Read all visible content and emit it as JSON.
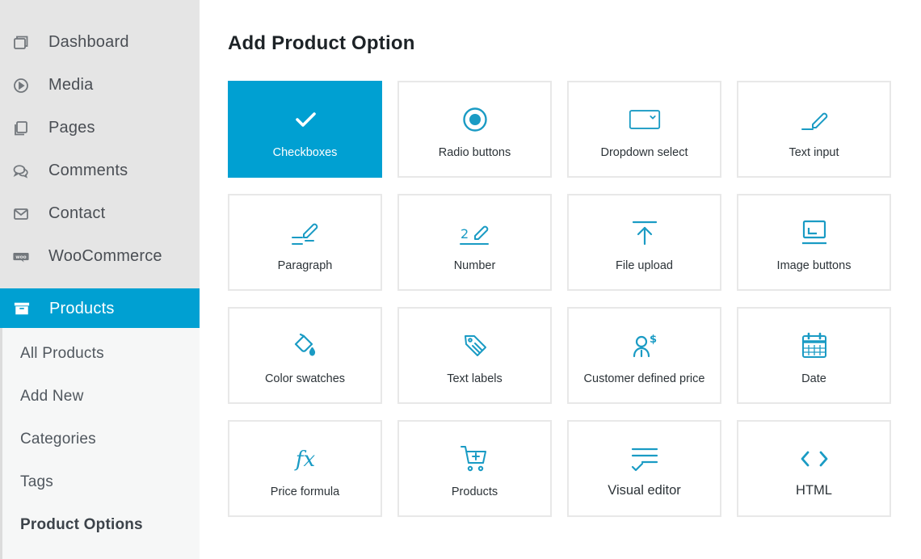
{
  "colors": {
    "accent": "#00a0d2",
    "icon": "#1a9bc4",
    "sidebar_bg": "#e5e5e5",
    "submenu_bg": "#f6f7f7"
  },
  "sidebar": {
    "items": [
      {
        "label": "Dashboard",
        "icon": "dashboard-icon"
      },
      {
        "label": "Media",
        "icon": "media-icon"
      },
      {
        "label": "Pages",
        "icon": "pages-icon"
      },
      {
        "label": "Comments",
        "icon": "comments-icon"
      },
      {
        "label": "Contact",
        "icon": "contact-icon"
      },
      {
        "label": "WooCommerce",
        "icon": "woocommerce-icon"
      },
      {
        "label": "Products",
        "icon": "products-icon",
        "active": true
      }
    ],
    "submenu": [
      {
        "label": "All Products"
      },
      {
        "label": "Add New"
      },
      {
        "label": "Categories"
      },
      {
        "label": "Tags"
      },
      {
        "label": "Product Options",
        "current": true
      }
    ]
  },
  "main": {
    "title": "Add Product Option",
    "options": [
      {
        "label": "Checkboxes",
        "icon": "checkmark-icon",
        "selected": true
      },
      {
        "label": "Radio buttons",
        "icon": "radio-icon"
      },
      {
        "label": "Dropdown select",
        "icon": "dropdown-icon"
      },
      {
        "label": "Text input",
        "icon": "text-input-icon"
      },
      {
        "label": "Paragraph",
        "icon": "paragraph-icon"
      },
      {
        "label": "Number",
        "icon": "number-icon"
      },
      {
        "label": "File upload",
        "icon": "upload-icon"
      },
      {
        "label": "Image buttons",
        "icon": "image-buttons-icon"
      },
      {
        "label": "Color swatches",
        "icon": "paint-bucket-icon"
      },
      {
        "label": "Text labels",
        "icon": "tag-icon"
      },
      {
        "label": "Customer defined price",
        "icon": "customer-price-icon"
      },
      {
        "label": "Date",
        "icon": "calendar-icon"
      },
      {
        "label": "Price formula",
        "icon": "formula-icon"
      },
      {
        "label": "Products",
        "icon": "cart-icon"
      },
      {
        "label": "Visual editor",
        "icon": "visual-editor-icon"
      },
      {
        "label": "HTML",
        "icon": "code-icon"
      }
    ]
  }
}
